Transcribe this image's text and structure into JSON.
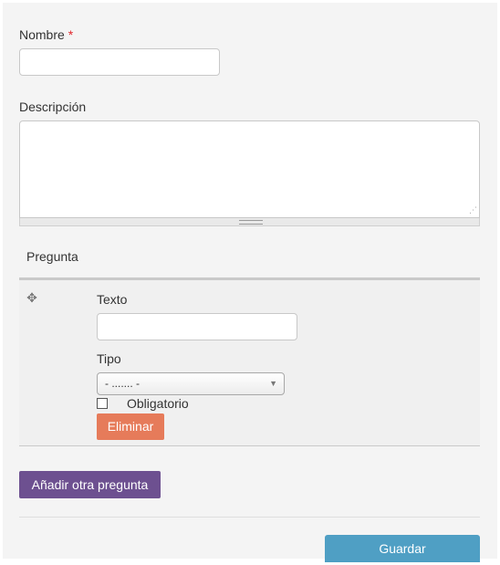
{
  "form": {
    "name_label": "Nombre",
    "required_marker": "*",
    "name_value": "",
    "description_label": "Descripción",
    "description_value": "",
    "question_header": "Pregunta",
    "question": {
      "text_label": "Texto",
      "text_value": "",
      "type_label": "Tipo",
      "type_selected": "- ....... -",
      "required_label": "Obligatorio",
      "required_checked": false,
      "delete_label": "Eliminar"
    },
    "add_question_label": "Añadir otra pregunta",
    "save_label": "Guardar"
  },
  "icons": {
    "drag": "move-icon",
    "dropdown": "chevron-down-icon",
    "resize": "resize-grip-icon"
  },
  "colors": {
    "required": "#e0262b",
    "delete_button": "#e67b5a",
    "add_button": "#6d5090",
    "save_button": "#4f9fc4"
  }
}
